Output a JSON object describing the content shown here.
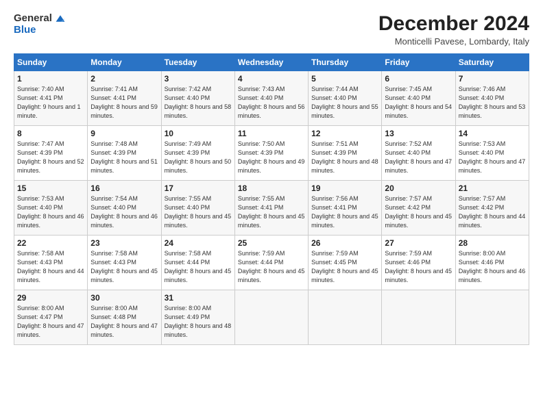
{
  "logo": {
    "general": "General",
    "blue": "Blue"
  },
  "header": {
    "month": "December 2024",
    "location": "Monticelli Pavese, Lombardy, Italy"
  },
  "weekdays": [
    "Sunday",
    "Monday",
    "Tuesday",
    "Wednesday",
    "Thursday",
    "Friday",
    "Saturday"
  ],
  "weeks": [
    [
      {
        "day": "1",
        "sunrise": "7:40 AM",
        "sunset": "4:41 PM",
        "daylight": "9 hours and 1 minute."
      },
      {
        "day": "2",
        "sunrise": "7:41 AM",
        "sunset": "4:41 PM",
        "daylight": "8 hours and 59 minutes."
      },
      {
        "day": "3",
        "sunrise": "7:42 AM",
        "sunset": "4:40 PM",
        "daylight": "8 hours and 58 minutes."
      },
      {
        "day": "4",
        "sunrise": "7:43 AM",
        "sunset": "4:40 PM",
        "daylight": "8 hours and 56 minutes."
      },
      {
        "day": "5",
        "sunrise": "7:44 AM",
        "sunset": "4:40 PM",
        "daylight": "8 hours and 55 minutes."
      },
      {
        "day": "6",
        "sunrise": "7:45 AM",
        "sunset": "4:40 PM",
        "daylight": "8 hours and 54 minutes."
      },
      {
        "day": "7",
        "sunrise": "7:46 AM",
        "sunset": "4:40 PM",
        "daylight": "8 hours and 53 minutes."
      }
    ],
    [
      {
        "day": "8",
        "sunrise": "7:47 AM",
        "sunset": "4:39 PM",
        "daylight": "8 hours and 52 minutes."
      },
      {
        "day": "9",
        "sunrise": "7:48 AM",
        "sunset": "4:39 PM",
        "daylight": "8 hours and 51 minutes."
      },
      {
        "day": "10",
        "sunrise": "7:49 AM",
        "sunset": "4:39 PM",
        "daylight": "8 hours and 50 minutes."
      },
      {
        "day": "11",
        "sunrise": "7:50 AM",
        "sunset": "4:39 PM",
        "daylight": "8 hours and 49 minutes."
      },
      {
        "day": "12",
        "sunrise": "7:51 AM",
        "sunset": "4:39 PM",
        "daylight": "8 hours and 48 minutes."
      },
      {
        "day": "13",
        "sunrise": "7:52 AM",
        "sunset": "4:40 PM",
        "daylight": "8 hours and 47 minutes."
      },
      {
        "day": "14",
        "sunrise": "7:53 AM",
        "sunset": "4:40 PM",
        "daylight": "8 hours and 47 minutes."
      }
    ],
    [
      {
        "day": "15",
        "sunrise": "7:53 AM",
        "sunset": "4:40 PM",
        "daylight": "8 hours and 46 minutes."
      },
      {
        "day": "16",
        "sunrise": "7:54 AM",
        "sunset": "4:40 PM",
        "daylight": "8 hours and 46 minutes."
      },
      {
        "day": "17",
        "sunrise": "7:55 AM",
        "sunset": "4:40 PM",
        "daylight": "8 hours and 45 minutes."
      },
      {
        "day": "18",
        "sunrise": "7:55 AM",
        "sunset": "4:41 PM",
        "daylight": "8 hours and 45 minutes."
      },
      {
        "day": "19",
        "sunrise": "7:56 AM",
        "sunset": "4:41 PM",
        "daylight": "8 hours and 45 minutes."
      },
      {
        "day": "20",
        "sunrise": "7:57 AM",
        "sunset": "4:42 PM",
        "daylight": "8 hours and 45 minutes."
      },
      {
        "day": "21",
        "sunrise": "7:57 AM",
        "sunset": "4:42 PM",
        "daylight": "8 hours and 44 minutes."
      }
    ],
    [
      {
        "day": "22",
        "sunrise": "7:58 AM",
        "sunset": "4:43 PM",
        "daylight": "8 hours and 44 minutes."
      },
      {
        "day": "23",
        "sunrise": "7:58 AM",
        "sunset": "4:43 PM",
        "daylight": "8 hours and 45 minutes."
      },
      {
        "day": "24",
        "sunrise": "7:58 AM",
        "sunset": "4:44 PM",
        "daylight": "8 hours and 45 minutes."
      },
      {
        "day": "25",
        "sunrise": "7:59 AM",
        "sunset": "4:44 PM",
        "daylight": "8 hours and 45 minutes."
      },
      {
        "day": "26",
        "sunrise": "7:59 AM",
        "sunset": "4:45 PM",
        "daylight": "8 hours and 45 minutes."
      },
      {
        "day": "27",
        "sunrise": "7:59 AM",
        "sunset": "4:46 PM",
        "daylight": "8 hours and 45 minutes."
      },
      {
        "day": "28",
        "sunrise": "8:00 AM",
        "sunset": "4:46 PM",
        "daylight": "8 hours and 46 minutes."
      }
    ],
    [
      {
        "day": "29",
        "sunrise": "8:00 AM",
        "sunset": "4:47 PM",
        "daylight": "8 hours and 47 minutes."
      },
      {
        "day": "30",
        "sunrise": "8:00 AM",
        "sunset": "4:48 PM",
        "daylight": "8 hours and 47 minutes."
      },
      {
        "day": "31",
        "sunrise": "8:00 AM",
        "sunset": "4:49 PM",
        "daylight": "8 hours and 48 minutes."
      },
      null,
      null,
      null,
      null
    ]
  ]
}
